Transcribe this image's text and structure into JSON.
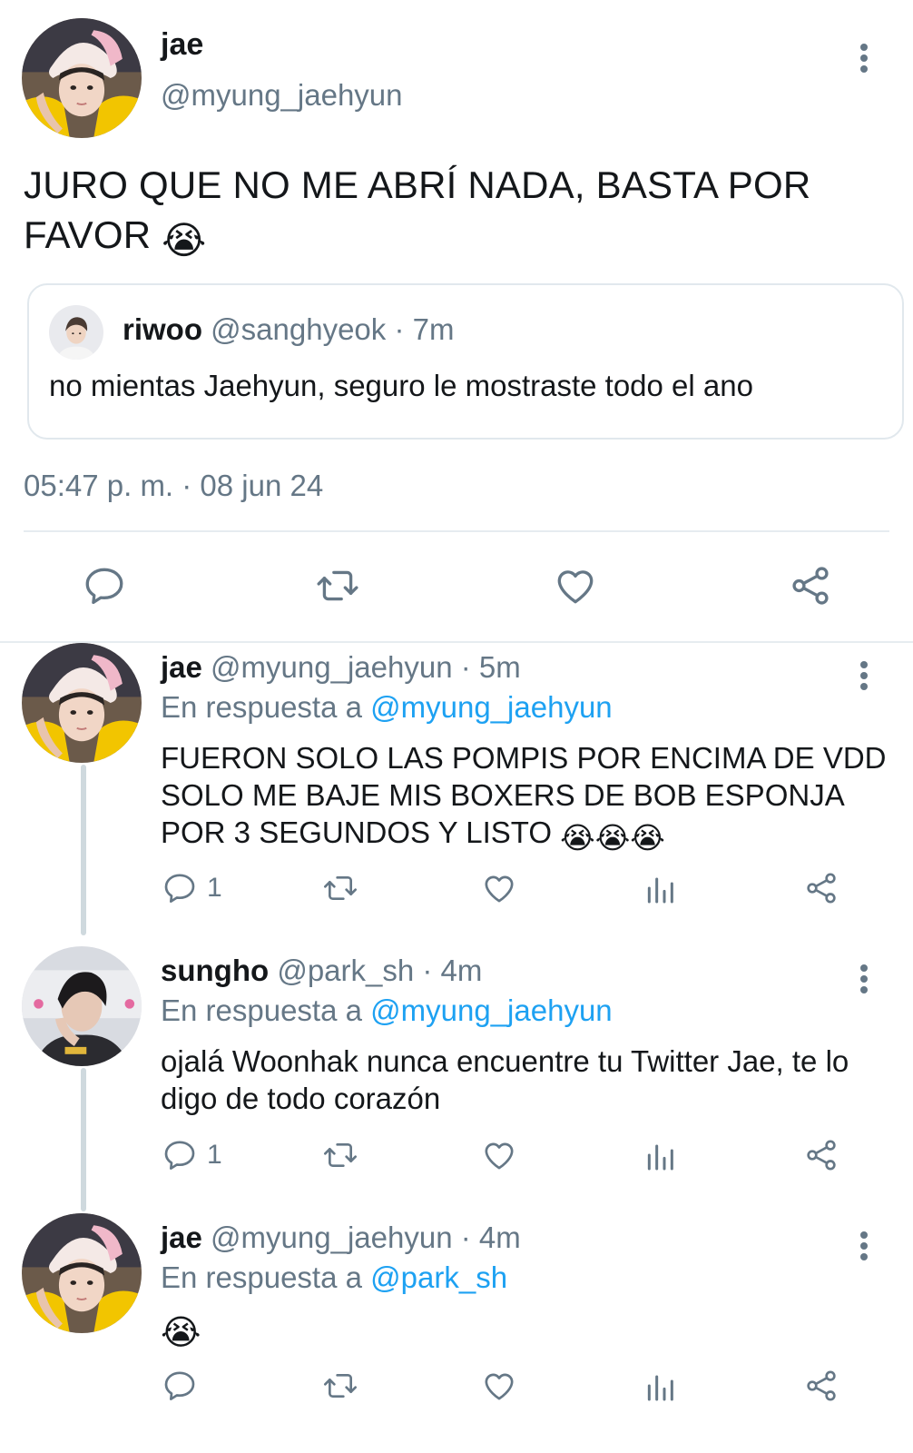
{
  "main_tweet": {
    "name": "jae",
    "handle": "@myung_jaehyun",
    "text": "JURO QUE NO ME ABRÍ NADA, BASTA POR FAVOR",
    "emoji": "😭",
    "quote": {
      "name": "riwoo",
      "meta": "@sanghyeok · 7m",
      "text": "no mientas Jaehyun, seguro le mostraste todo el ano"
    },
    "timestamp": "05:47 p. m. · 08 jun 24"
  },
  "replies": [
    {
      "name": "jae",
      "meta": "@myung_jaehyun · 5m",
      "reply_prefix": "En respuesta a ",
      "reply_to": "@myung_jaehyun",
      "text": "FUERON SOLO LAS POMPIS POR ENCIMA DE VDD SOLO ME BAJE MIS BOXERS DE BOB ESPONJA POR 3 SEGUNDOS Y LISTO",
      "emoji": "😭😭😭",
      "reply_count": "1"
    },
    {
      "name": "sungho",
      "meta": "@park_sh · 4m",
      "reply_prefix": "En respuesta a ",
      "reply_to": "@myung_jaehyun",
      "text": "ojalá Woonhak nunca encuentre tu Twitter Jae, te lo digo de todo corazón",
      "emoji": "",
      "reply_count": "1"
    },
    {
      "name": "jae",
      "meta": "@myung_jaehyun · 4m",
      "reply_prefix": "En respuesta a ",
      "reply_to": "@park_sh",
      "text": "",
      "emoji": "😭",
      "reply_count": ""
    }
  ],
  "colors": {
    "text": "#14171a",
    "secondary": "#657786",
    "link": "#1da1f2",
    "border": "#e1e8ed"
  },
  "icons": [
    "reply-icon",
    "retweet-icon",
    "like-icon",
    "share-icon",
    "analytics-icon",
    "more-icon"
  ]
}
